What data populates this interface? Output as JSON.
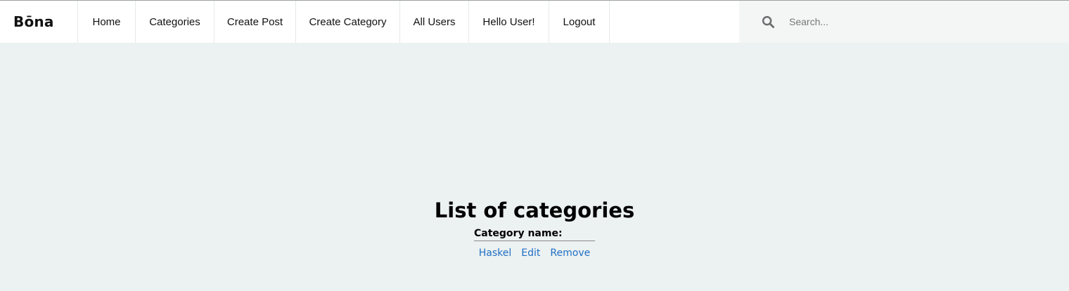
{
  "brand": "Bōna",
  "nav": {
    "items": [
      {
        "label": "Home"
      },
      {
        "label": "Categories"
      },
      {
        "label": "Create Post"
      },
      {
        "label": "Create Category"
      },
      {
        "label": "All Users"
      },
      {
        "label": "Hello User!"
      },
      {
        "label": "Logout"
      }
    ]
  },
  "search": {
    "icon": "search-icon",
    "placeholder": "Search..."
  },
  "main": {
    "title": "List of categories",
    "table": {
      "column_header": "Category name:",
      "rows": [
        {
          "name": "Haskel",
          "edit_label": "Edit",
          "remove_label": "Remove"
        }
      ]
    }
  },
  "colors": {
    "page_background": "#ecf1f1",
    "header_background": "#ffffff",
    "search_background": "#f4f5f5",
    "link": "#1f6fc5"
  }
}
